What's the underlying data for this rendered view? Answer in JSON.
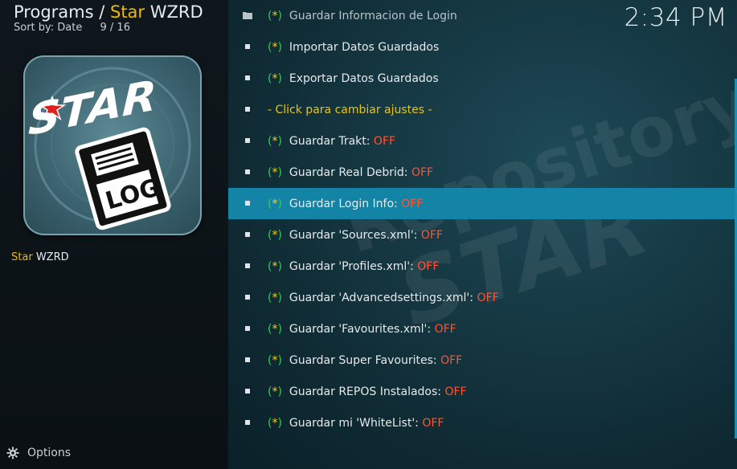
{
  "header": {
    "prefix": "Programs /",
    "accent": "Star",
    "suffix": "WZRD",
    "sort_label": "Sort by: Date",
    "position": "9 / 16"
  },
  "clock": "2:34 PM",
  "addon": {
    "accent": "Star",
    "suffix": "WZRD"
  },
  "footer": {
    "options_label": "Options"
  },
  "thumbnail": {
    "logo_text": "STAR",
    "badge_text": "LOG"
  },
  "watermark": {
    "line1": "Repository",
    "line2": "STAR"
  },
  "colors": {
    "accent": "#f5b800",
    "selected_row": "#1384a6",
    "off_status": "#ff5533",
    "paren": "#38c95a",
    "star": "#f5d300"
  },
  "items": [
    {
      "icon": "folder-icon",
      "open": "(",
      "mark": "*",
      "close": ")",
      "label": "Guardar Informacion de Login",
      "status": ""
    },
    {
      "icon": "bullet-icon",
      "open": "(",
      "mark": "*",
      "close": ")",
      "label": "Importar Datos Guardados",
      "status": ""
    },
    {
      "icon": "bullet-icon",
      "open": "(",
      "mark": "*",
      "close": ")",
      "label": "Exportar Datos Guardados",
      "status": ""
    },
    {
      "icon": "bullet-icon",
      "hint": "- Click para cambiar ajustes -"
    },
    {
      "icon": "bullet-icon",
      "open": "(",
      "mark": "*",
      "close": ")",
      "label": "Guardar Trakt:",
      "status": "OFF"
    },
    {
      "icon": "bullet-icon",
      "open": "(",
      "mark": "*",
      "close": ")",
      "label": "Guardar Real Debrid:",
      "status": "OFF"
    },
    {
      "icon": "bullet-icon",
      "open": "(",
      "mark": "*",
      "close": ")",
      "label": "Guardar Login Info:",
      "status": "OFF",
      "selected": true
    },
    {
      "icon": "bullet-icon",
      "open": "(",
      "mark": "*",
      "close": ")",
      "label": "Guardar 'Sources.xml':",
      "status": "OFF"
    },
    {
      "icon": "bullet-icon",
      "open": "(",
      "mark": "*",
      "close": ")",
      "label": "Guardar 'Profiles.xml':",
      "status": "OFF"
    },
    {
      "icon": "bullet-icon",
      "open": "(",
      "mark": "*",
      "close": ")",
      "label": "Guardar 'Advancedsettings.xml':",
      "status": "OFF"
    },
    {
      "icon": "bullet-icon",
      "open": "(",
      "mark": "*",
      "close": ")",
      "label": "Guardar 'Favourites.xml':",
      "status": "OFF"
    },
    {
      "icon": "bullet-icon",
      "open": "(",
      "mark": "*",
      "close": ")",
      "label": "Guardar Super Favourites:",
      "status": "OFF"
    },
    {
      "icon": "bullet-icon",
      "open": "(",
      "mark": "*",
      "close": ")",
      "label": "Guardar REPOS Instalados:",
      "status": "OFF"
    },
    {
      "icon": "bullet-icon",
      "open": "(",
      "mark": "*",
      "close": ")",
      "label": "Guardar mi 'WhiteList':",
      "status": "OFF"
    }
  ]
}
